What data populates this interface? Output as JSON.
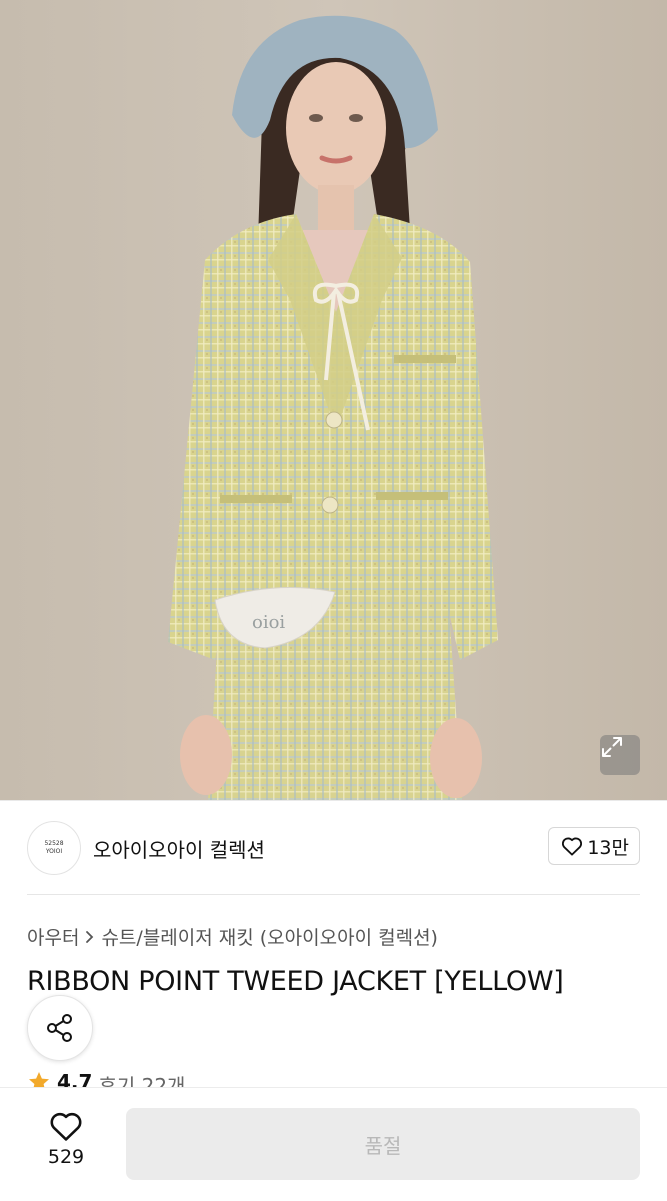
{
  "product_image": {
    "alt": "",
    "expand_icon": "expand-icon"
  },
  "brand": {
    "logo_line1": "52528",
    "logo_line2": "YOIOI",
    "name": "오아이오아이 컬렉션",
    "like_icon": "heart-outline-icon",
    "like_count": "13만"
  },
  "product": {
    "breadcrumb_category": "아우터",
    "breadcrumb_subcategory": "슈트/블레이저 재킷 (오아이오아이 컬렉션)",
    "title": "RIBBON POINT TWEED JACKET [YELLOW]",
    "share_icon": "share-icon",
    "rating": "4.7",
    "review_count": "후기 22개"
  },
  "bottom_bar": {
    "wish_icon": "heart-outline-icon",
    "wish_count": "529",
    "buy_label": "품절"
  },
  "colors": {
    "sold_out_bg": "#ebebeb",
    "sold_out_text": "#b8b8b8",
    "star": "#f2a92b"
  }
}
